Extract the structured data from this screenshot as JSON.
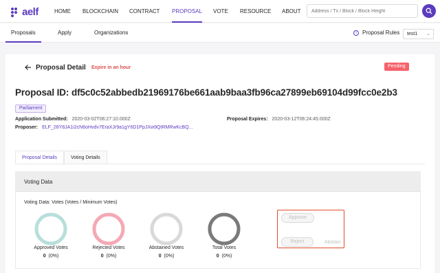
{
  "brand": {
    "logo_text": "aelf"
  },
  "nav": {
    "items": [
      "HOME",
      "BLOCKCHAIN",
      "CONTRACT",
      "PROPOSAL",
      "VOTE",
      "RESOURCE",
      "ABOUT"
    ],
    "active": "PROPOSAL"
  },
  "search": {
    "placeholder": "Address / Tx / Block / Block Height",
    "icon": "search-icon"
  },
  "subnav": {
    "tabs": [
      "Proposals",
      "Apply",
      "Organizations"
    ],
    "active": "Proposals",
    "rules_label": "Proposal Rules",
    "chain_select": "test1"
  },
  "detail": {
    "back_icon": "arrow-left-icon",
    "title": "Proposal Detail",
    "expire_note": "Expire in an hour",
    "status": "Pending",
    "proposal_id": "Proposal ID: df5c0c52abbedb21969176be661aab9baa3fb96ca27899eb69104d99fcc0e2b3",
    "tag": "Parliament",
    "submitted_label": "Application Submitted:",
    "submitted_value": "2020-03-02T06:27:10.000Z",
    "expires_label": "Proposal Expires:",
    "expires_value": "2020-03-12T06:24:45.000Z",
    "proposer_label": "Proposer:",
    "proposer_value": "ELF_28Y8JA1i2cN6oHvdv7EraXJr9a1gY6D1PpJXw9QtRMRwKcBQ..."
  },
  "detail_tabs": [
    "Proposal Details",
    "Voting Details"
  ],
  "voting": {
    "title": "Voting Data",
    "subtitle": "Voting Data: Votes (Votes / Minimum Votes)",
    "stats": [
      {
        "label": "Approved Votes",
        "count": "0",
        "pct": "(0%)",
        "color": "#b7dfdb",
        "fill": 0
      },
      {
        "label": "Rejected Votes",
        "count": "0",
        "pct": "(0%)",
        "color": "#f4a9b4",
        "fill": 0
      },
      {
        "label": "Abstained Votes",
        "count": "0",
        "pct": "(0%)",
        "color": "#d9d9d9",
        "fill": 0
      },
      {
        "label": "Total Votes",
        "count": "0",
        "pct": "(0%)",
        "color": "#7a7a7a",
        "fill": 0
      }
    ],
    "buttons": {
      "approve": "Approve",
      "reject": "Reject",
      "abstain": "Abstain"
    }
  },
  "colors": {
    "accent": "#5b3bbf",
    "danger": "#f5626a",
    "highlight_box": "#e24a2a"
  }
}
